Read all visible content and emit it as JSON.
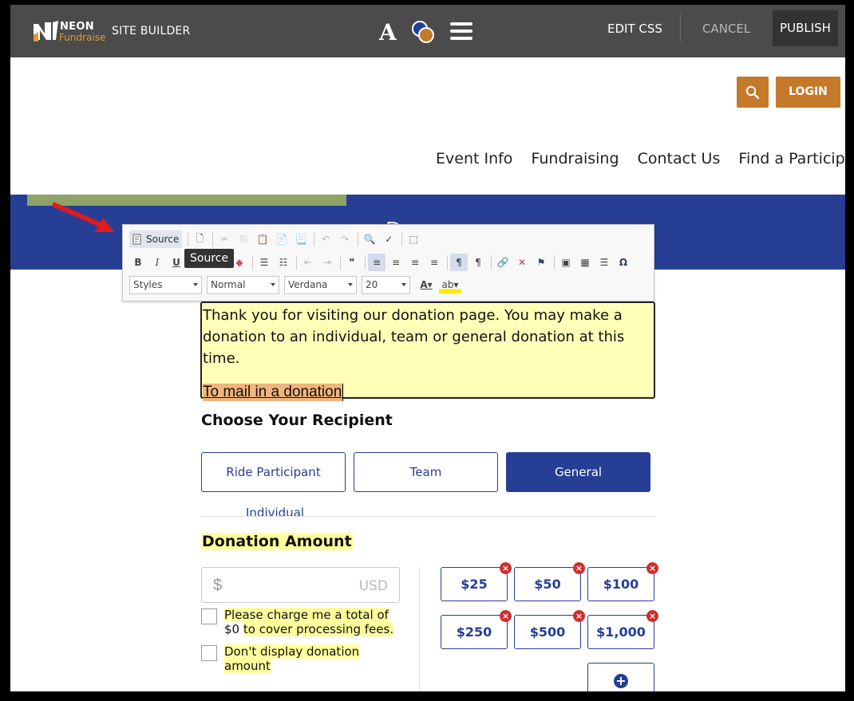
{
  "builder_bar": {
    "brand_name": "NEON",
    "brand_sub": "Fundraise",
    "site_builder": "SITE BUILDER",
    "font_icon_glyph": "A",
    "edit_css": "EDIT CSS",
    "cancel": "CANCEL",
    "publish": "PUBLISH"
  },
  "site_header": {
    "login": "LOGIN",
    "nav": [
      "Event Info",
      "Fundraising",
      "Contact Us",
      "Find a Participant"
    ]
  },
  "banner": {
    "partial_text": "D"
  },
  "editor": {
    "source_label": "Source",
    "tooltip": "Source",
    "styles": "Styles",
    "format": "Normal",
    "font": "Verdana",
    "size": "20"
  },
  "content": {
    "intro": "Thank you for visiting our donation page.  You may make a donation to an individual, team or general donation at this time.",
    "mail_link": "To mail in a donation"
  },
  "recipient": {
    "title": "Choose Your Recipient",
    "buttons": [
      "Ride Participant",
      "Team",
      "General"
    ],
    "sub_label": "Individual"
  },
  "donation": {
    "title": "Donation Amount",
    "currency_symbol": "$",
    "currency_code": "USD",
    "fee_text_a": "Please charge me a total of",
    "fee_text_b": "$0",
    "fee_text_c": "to cover processing fees.",
    "anon_text_a": "Don't display donation",
    "anon_text_b": "amount",
    "amounts": [
      "$25",
      "$50",
      "$100",
      "$250",
      "$500",
      "$1,000"
    ],
    "add_glyph": "+"
  },
  "colors": {
    "accent_blue": "#263f94",
    "brand_orange": "#c57a2a",
    "highlight_yellow": "#ffff9e",
    "delete_red": "#d12e2e"
  }
}
